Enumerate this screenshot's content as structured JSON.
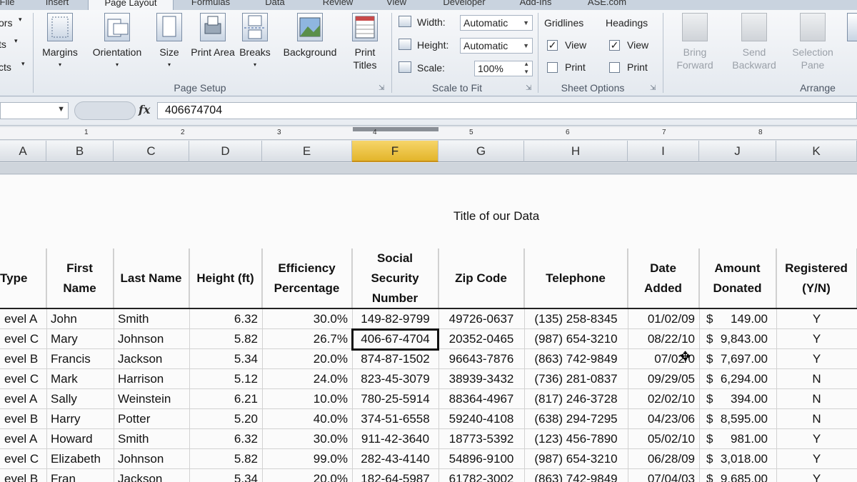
{
  "tabs": [
    "File",
    "Insert",
    "Page Layout",
    "Formulas",
    "Data",
    "Review",
    "View",
    "Developer",
    "Add-Ins",
    "ASE.com"
  ],
  "ribbon": {
    "left_partial": [
      "ors",
      "ts",
      "cts"
    ],
    "page_setup": {
      "buttons": [
        {
          "label": "Margins",
          "icon": "margins-icon"
        },
        {
          "label": "Orientation",
          "icon": "orientation-icon"
        },
        {
          "label": "Size",
          "icon": "size-icon"
        },
        {
          "label": "Print Area",
          "icon": "print-area-icon"
        },
        {
          "label": "Breaks",
          "icon": "breaks-icon"
        },
        {
          "label": "Background",
          "icon": "background-icon"
        },
        {
          "label": "Print Titles",
          "icon": "print-titles-icon"
        }
      ],
      "group_label": "Page Setup"
    },
    "scale_to_fit": {
      "width_label": "Width:",
      "width_value": "Automatic",
      "height_label": "Height:",
      "height_value": "Automatic",
      "scale_label": "Scale:",
      "scale_value": "100%",
      "group_label": "Scale to Fit"
    },
    "sheet_options": {
      "gridlines_label": "Gridlines",
      "headings_label": "Headings",
      "view_label": "View",
      "print_label": "Print",
      "gridlines_view": true,
      "gridlines_print": false,
      "headings_view": true,
      "headings_print": false,
      "group_label": "Sheet Options"
    },
    "arrange": {
      "bring_forward": "Bring Forward",
      "send_backward": "Send Backward",
      "selection_pane": "Selection Pane",
      "group_label": "Arrange"
    }
  },
  "formula_bar": {
    "fx": "fx",
    "value": "406674704"
  },
  "ruler_numbers": [
    "1",
    "2",
    "3",
    "4",
    "5",
    "6",
    "7",
    "8"
  ],
  "columns": [
    "A",
    "B",
    "C",
    "D",
    "E",
    "F",
    "G",
    "H",
    "I",
    "J",
    "K"
  ],
  "selected_column": "F",
  "sheet_title": "Title of our Data",
  "headers": [
    "Type",
    "First Name",
    "Last Name",
    "Height (ft)",
    "Efficiency Percentage",
    "Social Security Number",
    "Zip Code",
    "Telephone",
    "Date Added",
    "Amount Donated",
    "Registered (Y/N)"
  ],
  "rows": [
    [
      "evel A",
      "John",
      "Smith",
      "6.32",
      "30.0%",
      "149-82-9799",
      "49726-0637",
      "(135) 258-8345",
      "01/02/09",
      "149.00",
      "Y"
    ],
    [
      "evel C",
      "Mary",
      "Johnson",
      "5.82",
      "26.7%",
      "406-67-4704",
      "20352-0465",
      "(987) 654-3210",
      "08/22/10",
      "9,843.00",
      "Y"
    ],
    [
      "evel B",
      "Francis",
      "Jackson",
      "5.34",
      "20.0%",
      "874-87-1502",
      "96643-7876",
      "(863) 742-9849",
      "07/02/0",
      "7,697.00",
      "Y"
    ],
    [
      "evel C",
      "Mark",
      "Harrison",
      "5.12",
      "24.0%",
      "823-45-3079",
      "38939-3432",
      "(736) 281-0837",
      "09/29/05",
      "6,294.00",
      "N"
    ],
    [
      "evel A",
      "Sally",
      "Weinstein",
      "6.21",
      "10.0%",
      "780-25-5914",
      "88364-4967",
      "(817) 246-3728",
      "02/02/10",
      "394.00",
      "N"
    ],
    [
      "evel B",
      "Harry",
      "Potter",
      "5.20",
      "40.0%",
      "374-51-6558",
      "59240-4108",
      "(638) 294-7295",
      "04/23/06",
      "8,595.00",
      "N"
    ],
    [
      "evel A",
      "Howard",
      "Smith",
      "6.32",
      "30.0%",
      "911-42-3640",
      "18773-5392",
      "(123) 456-7890",
      "05/02/10",
      "981.00",
      "Y"
    ],
    [
      "evel C",
      "Elizabeth",
      "Johnson",
      "5.82",
      "99.0%",
      "282-43-4140",
      "54896-9100",
      "(987) 654-3210",
      "06/28/09",
      "3,018.00",
      "Y"
    ],
    [
      "evel B",
      "Fran",
      "Jackson",
      "5.34",
      "20.0%",
      "182-64-5987",
      "61782-3002",
      "(863) 742-9849",
      "07/04/03",
      "9,685.00",
      "Y"
    ]
  ],
  "currency_symbol": "$",
  "active_cell": "F2",
  "colors": {
    "selected_column": "#f0c94a",
    "ribbon_bg": "#eef1f5",
    "sheet_bg": "#fbfbfb"
  }
}
